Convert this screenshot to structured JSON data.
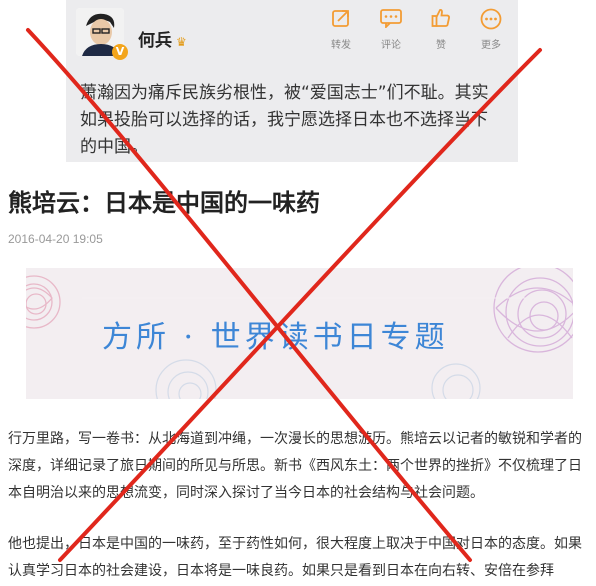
{
  "post": {
    "username": "何兵",
    "crown_icon": "crown-icon",
    "verified_mark": "V",
    "actions": [
      {
        "label": "转发",
        "icon": "share-icon"
      },
      {
        "label": "评论",
        "icon": "comment-icon"
      },
      {
        "label": "赞",
        "icon": "like-icon"
      },
      {
        "label": "更多",
        "icon": "more-icon"
      }
    ],
    "text": "萧瀚因为痛斥民族劣根性，被“爱国志士”们不耻。其实如果投胎可以选择的话，我宁愿选择日本也不选择当下的中国。"
  },
  "article": {
    "title": "熊培云：日本是中国的一味药",
    "date": "2016-04-20 19:05",
    "banner_text": "方所 · 世界读书日专题",
    "paragraphs": [
      "行万里路，写一卷书：从北海道到冲绳，一次漫长的思想游历。熊培云以记者的敏锐和学者的深度，详细记录了旅日期间的所见与所思。新书《西风东土：两个世界的挫折》不仅梳理了日本自明治以来的思想流变，同时深入探讨了当今日本的社会结构与社会问题。",
      "他也提出，日本是中国的一味药，至于药性如何，很大程度上取决于中国对日本的态度。如果认真学习日本的社会建设，日本将是一味良药。如果只是看到日本在向右转、安倍在参拜"
    ]
  },
  "colors": {
    "accent_orange": "#f39c34",
    "cross_red": "#e0271c",
    "banner_text": "#3d86d6",
    "card_bg": "#ececee"
  }
}
